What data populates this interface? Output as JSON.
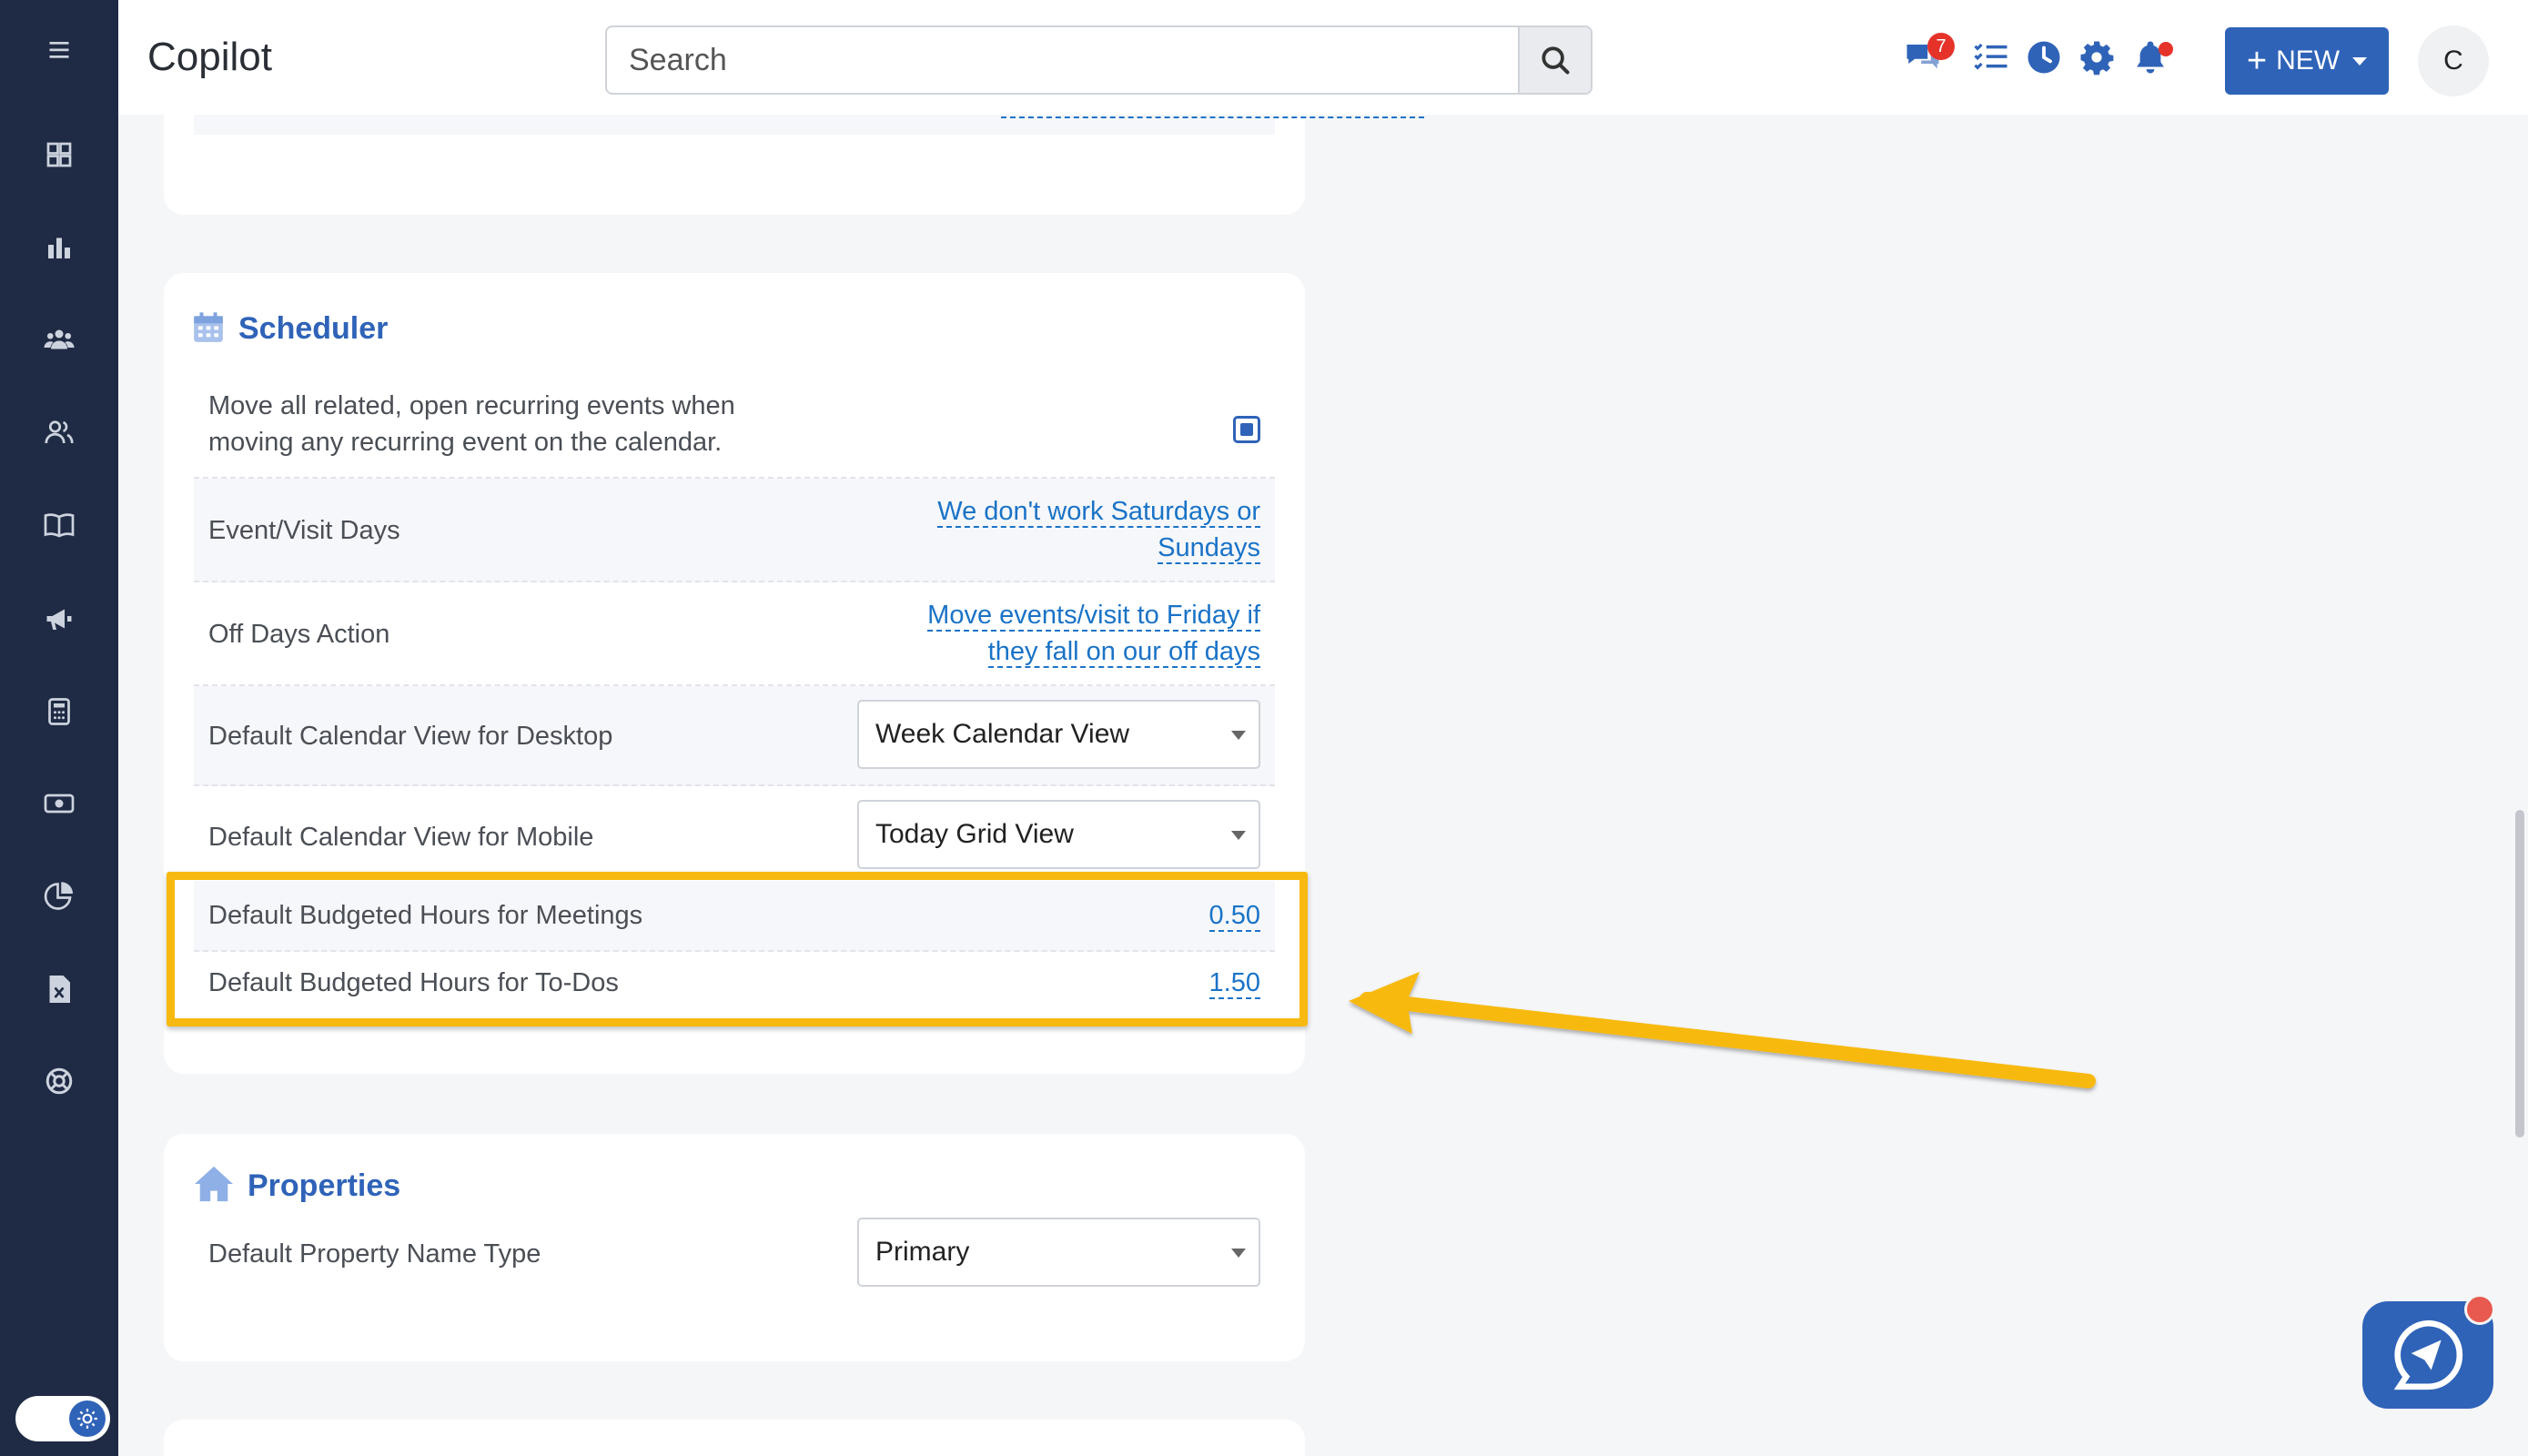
{
  "app": {
    "title": "Copilot"
  },
  "search": {
    "placeholder": "Search"
  },
  "header": {
    "message_count": "7",
    "new_label": "NEW",
    "avatar_initial": "C"
  },
  "scheduler": {
    "title": "Scheduler",
    "recurring_label_line1": "Move all related, open recurring events when",
    "recurring_label_line2": "moving any recurring event on the calendar.",
    "event_days_label": "Event/Visit Days",
    "event_days_value_line1": "We don't work Saturdays or",
    "event_days_value_line2": "Sundays",
    "off_days_label": "Off Days Action",
    "off_days_value_line1": "Move events/visit to Friday if",
    "off_days_value_line2": "they fall on our off days",
    "desktop_view_label": "Default Calendar View for Desktop",
    "desktop_view_value": "Week Calendar View",
    "mobile_view_label": "Default Calendar View for Mobile",
    "mobile_view_value": "Today Grid View",
    "meetings_hours_label": "Default Budgeted Hours for Meetings",
    "meetings_hours_value": "0.50",
    "todos_hours_label": "Default Budgeted Hours for To-Dos",
    "todos_hours_value": "1.50"
  },
  "properties": {
    "title": "Properties",
    "name_type_label": "Default Property Name Type",
    "name_type_value": "Primary"
  },
  "colors": {
    "sidebar": "#1f2b44",
    "accent": "#2f63b8",
    "link": "#1a73c7",
    "highlight": "#f7b90f"
  }
}
